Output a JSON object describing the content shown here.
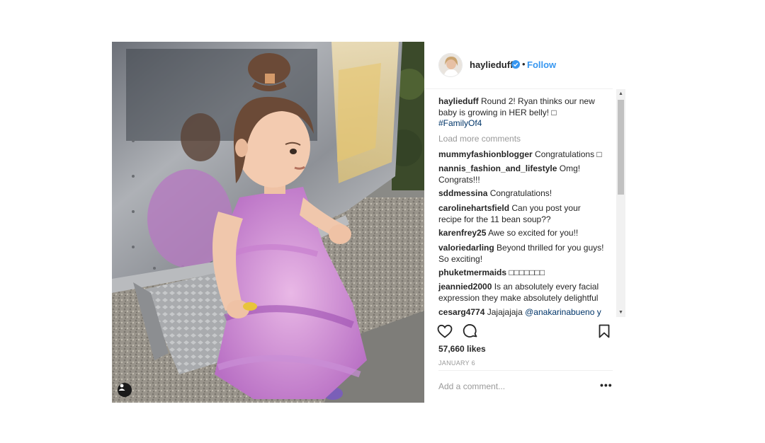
{
  "post": {
    "username": "haylieduff",
    "follow_label": "Follow",
    "separator": "•",
    "caption": {
      "username": "haylieduff",
      "text": "Round 2! Ryan thinks our new baby is growing in HER belly! □",
      "hashtag": "#FamilyOf4"
    },
    "load_more": "Load more comments",
    "comments": [
      {
        "user": "mummyfashionblogger",
        "text": "Congratulations □"
      },
      {
        "user": "nannis_fashion_and_lifestyle",
        "text": "Omg! Congrats!!!"
      },
      {
        "user": "sddmessina",
        "text": "Congratulations!"
      },
      {
        "user": "carolinehartsfield",
        "text": "Can you post your recipe for the 11 bean soup??"
      },
      {
        "user": "karenfrey25",
        "text": "Awe so excited for you!!"
      },
      {
        "user": "valoriedarling",
        "text": "Beyond thrilled for you guys! So exciting!"
      },
      {
        "user": "phuketmermaids",
        "text": "□□□□□□□"
      },
      {
        "user": "jeannied2000",
        "text": "Is an absolutely every facial expression they make absolutely delightful"
      },
      {
        "user": "cesarg4774",
        "text": "Jajajajaja",
        "mention": "@anakarinabueno y"
      }
    ],
    "likes": "57,660 likes",
    "date": "JANUARY 6",
    "add_comment_placeholder": "Add a comment...",
    "more_label": "•••",
    "scroll_up": "▲",
    "scroll_down": "▼"
  },
  "icons": {
    "verified": "verified-badge-icon",
    "like": "heart-icon",
    "comment": "comment-bubble-icon",
    "save": "bookmark-icon",
    "user_tag": "user-tag-icon"
  },
  "colors": {
    "link_blue": "#3897f0",
    "hashtag": "#003569",
    "muted": "#999999",
    "text": "#262626"
  }
}
